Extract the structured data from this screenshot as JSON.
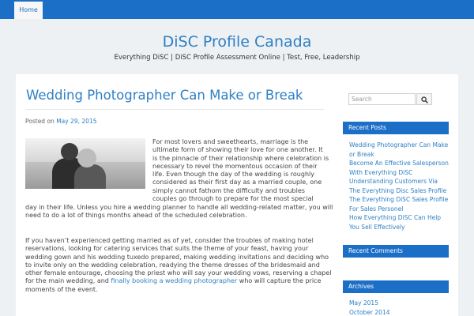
{
  "nav": {
    "home": "Home"
  },
  "site": {
    "title": "DiSC Profile Canada",
    "description": "Everything DiSC | DiSC Profile Assessment Online | Test, Free, Leadership"
  },
  "post": {
    "title": "Wedding Photographer Can Make or Break",
    "meta_prefix": "Posted on",
    "date": "May 29, 2015",
    "image_alt": "Couple embracing",
    "para1_lines": [
      "For most lovers and sweethearts, marriage is the",
      "ultimate form of showing their love for one another. It",
      "is the pinnacle of their relationship where celebration is",
      "necessary to revel the momentous occasion of their",
      "life. Even though the day of the wedding is roughly",
      "considered as their first day as a married couple, one",
      "simply cannot fathom the difficulty and troubles",
      "couples go through to prepare for the most special"
    ],
    "para1_full_lines": [
      "day in their life. Unless you hire a wedding planner to handle all wedding-related matter, you will",
      "need to do a lot of things months ahead of the scheduled celebration."
    ],
    "para2_lines": [
      "If you haven’t experienced getting married as of yet, consider the troubles of making hotel",
      "reservations, looking for catering services that suits the theme of your feast, having your",
      "wedding gown and his wedding tuxedo prepared, making wedding invitations and deciding who",
      "to invite only on the wedding celebration, readying the theme dresses of the bridesmaid and",
      "other female entourage, choosing the priest who will say your wedding vows, reserving a chapel"
    ],
    "para2_last_prefix": "for the main wedding, and ",
    "para2_link": "finally booking a wedding photographer",
    "para2_last_suffix": " who will capture the price",
    "para2_end": "moments of the event."
  },
  "sidebar": {
    "search_placeholder": "Search",
    "recent_posts_title": "Recent Posts",
    "recent_posts": [
      "Wedding Photographer Can Make",
      "or Break",
      "Become An Effective Salesperson",
      "With Everything DiSC",
      "Understanding Customers Via",
      "The Everything Disc Sales Profile",
      "The Everything DiSC Sales Profile",
      "For Sales Personel",
      "How Everything DiSC Can Help",
      "You Sell Effectively"
    ],
    "recent_comments_title": "Recent Comments",
    "archives_title": "Archives",
    "archives": [
      "May 2015",
      "October 2014"
    ]
  },
  "colors": {
    "accent": "#1b6fc7",
    "link": "#2f7fc4",
    "background": "#eef1f4"
  },
  "icons": {
    "search": "magnifier-icon"
  }
}
